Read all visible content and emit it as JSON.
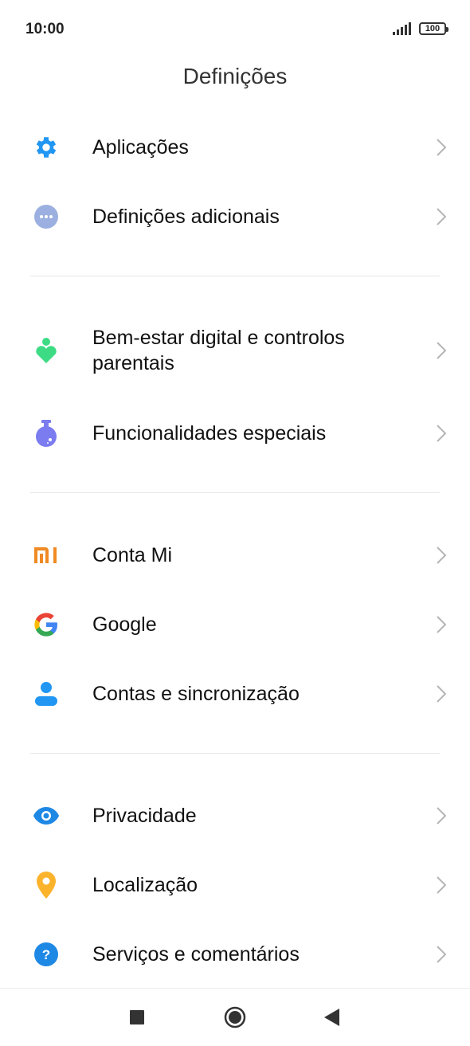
{
  "status_bar": {
    "time": "10:00",
    "battery": "100"
  },
  "header": {
    "title": "Definições"
  },
  "items": [
    {
      "label": "Aplicações",
      "icon": "gear-icon",
      "color": "#2196f3"
    },
    {
      "label": "Definições adicionais",
      "icon": "more-icon",
      "color": "#9bb0e0"
    },
    {
      "label": "Bem-estar digital e controlos parentais",
      "icon": "wellbeing-icon",
      "color": "#3ddc84"
    },
    {
      "label": "Funcionalidades especiais",
      "icon": "flask-icon",
      "color": "#7b7cf0"
    },
    {
      "label": "Conta Mi",
      "icon": "mi-logo-icon",
      "color": "#f08a24"
    },
    {
      "label": "Google",
      "icon": "google-logo-icon",
      "color": "#4285f4"
    },
    {
      "label": "Contas e sincronização",
      "icon": "user-icon",
      "color": "#2196f3"
    },
    {
      "label": "Privacidade",
      "icon": "eye-icon",
      "color": "#1e88e5"
    },
    {
      "label": "Localização",
      "icon": "location-pin-icon",
      "color": "#fbb32b"
    },
    {
      "label": "Serviços e comentários",
      "icon": "help-icon",
      "color": "#1e88e5"
    }
  ],
  "nav_bar": {
    "buttons": [
      "recents-button",
      "home-button",
      "back-button"
    ]
  }
}
